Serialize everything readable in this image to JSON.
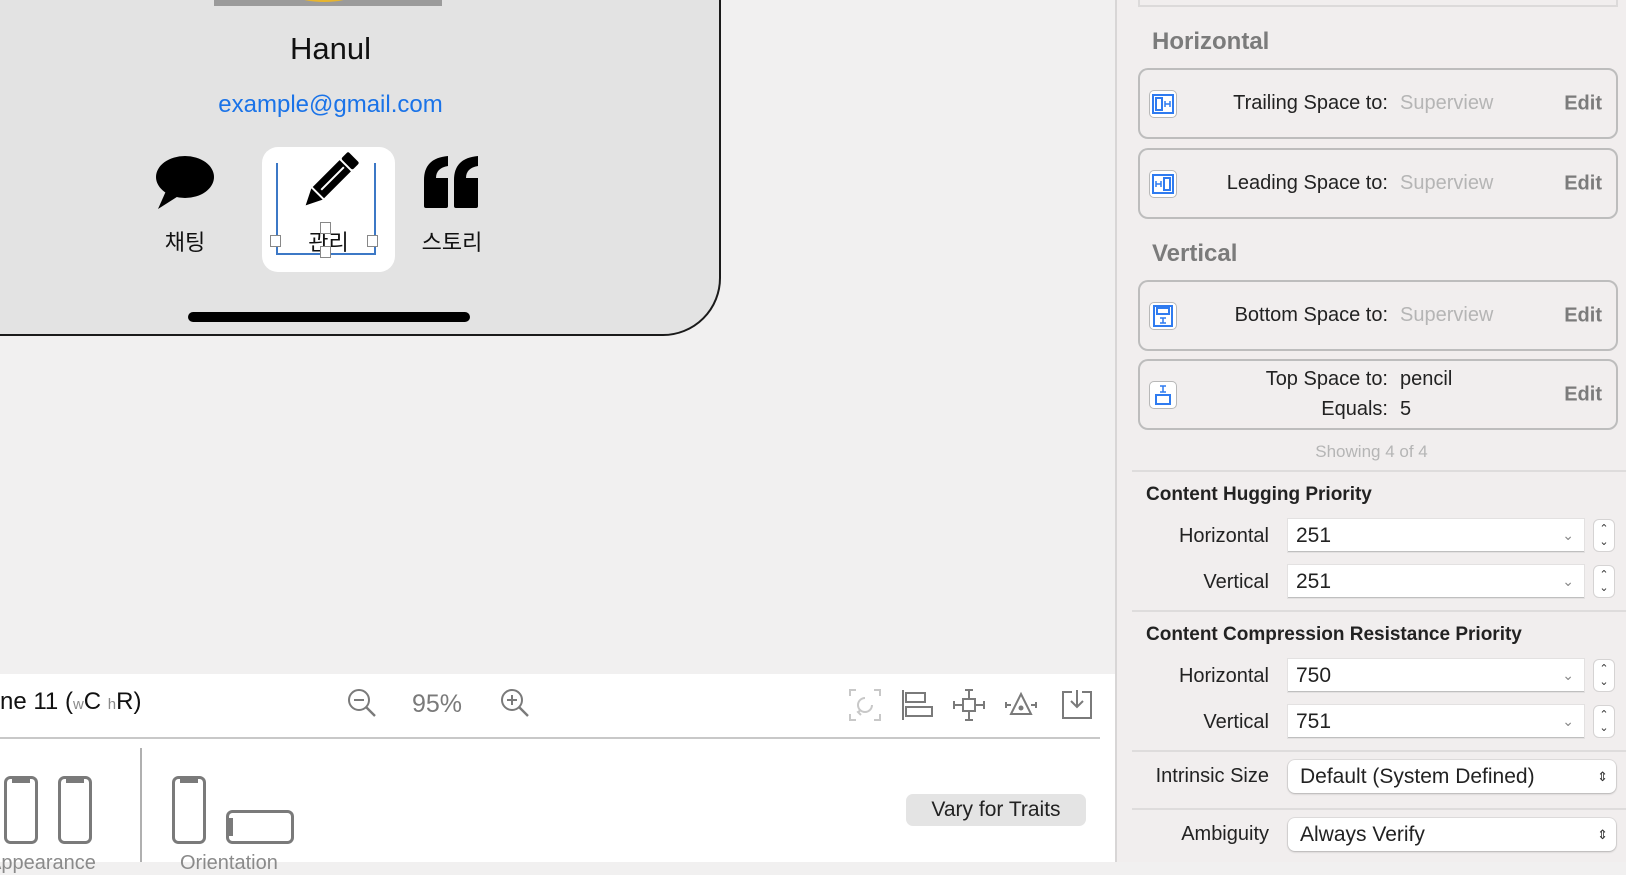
{
  "canvas": {
    "profile": {
      "name": "Hanul",
      "email": "example@gmail.com"
    },
    "actions": [
      {
        "label": "채팅",
        "icon": "chat-bubble-icon"
      },
      {
        "label": "관리",
        "icon": "pencil-icon",
        "selected": true
      },
      {
        "label": "스토리",
        "icon": "quote-icon"
      }
    ]
  },
  "bottom_bar": {
    "device_prefix": "ne 11 (",
    "device_w": "w",
    "device_c": "C",
    "device_h": "h",
    "device_r": "R)",
    "zoom_level": "95%",
    "vary_for_traits": "Vary for Traits",
    "appearance_label": "Appearance",
    "orientation_label": "Orientation"
  },
  "inspector": {
    "horizontal_title": "Horizontal",
    "vertical_title": "Vertical",
    "constraints": [
      {
        "label": "Trailing Space to:",
        "value": "Superview",
        "muted": true,
        "edit": "Edit",
        "icon": "trailing-space-icon"
      },
      {
        "label": "Leading Space to:",
        "value": "Superview",
        "muted": true,
        "edit": "Edit",
        "icon": "leading-space-icon"
      },
      {
        "label": "Bottom Space to:",
        "value": "Superview",
        "muted": true,
        "edit": "Edit",
        "icon": "bottom-space-icon"
      },
      {
        "label": "Top Space to:",
        "value": "pencil",
        "label2": "Equals:",
        "value2": "5",
        "muted": false,
        "edit": "Edit",
        "icon": "top-space-icon"
      }
    ],
    "showing": "Showing 4 of 4",
    "hugging": {
      "title": "Content Hugging Priority",
      "horizontal_label": "Horizontal",
      "horizontal_value": "251",
      "vertical_label": "Vertical",
      "vertical_value": "251"
    },
    "compression": {
      "title": "Content Compression Resistance Priority",
      "horizontal_label": "Horizontal",
      "horizontal_value": "750",
      "vertical_label": "Vertical",
      "vertical_value": "751"
    },
    "intrinsic_size": {
      "label": "Intrinsic Size",
      "value": "Default (System Defined)"
    },
    "ambiguity": {
      "label": "Ambiguity",
      "value": "Always Verify"
    }
  },
  "colors": {
    "accent": "#1a73e8",
    "constraint_icon": "#2f7bf0",
    "selection": "#3c78c6"
  }
}
